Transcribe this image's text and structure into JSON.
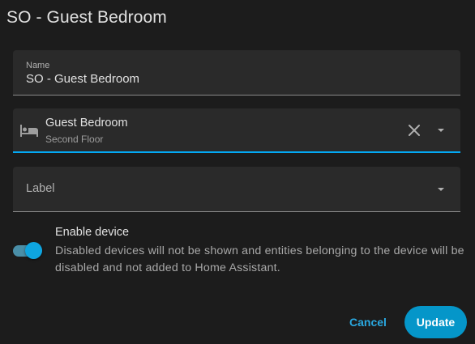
{
  "dialog": {
    "title": "SO - Guest Bedroom"
  },
  "name_field": {
    "label": "Name",
    "value": "SO - Guest Bedroom"
  },
  "area_field": {
    "icon": "bed-icon",
    "primary": "Guest Bedroom",
    "secondary": "Second Floor",
    "clear_icon": "close-icon",
    "dropdown_icon": "chevron-down-icon"
  },
  "label_field": {
    "placeholder": "Label",
    "dropdown_icon": "chevron-down-icon"
  },
  "enable_device": {
    "title": "Enable device",
    "description": "Disabled devices will not be shown and entities belonging to the device will be disabled and not added to Home Assistant.",
    "enabled": true
  },
  "actions": {
    "cancel_label": "Cancel",
    "update_label": "Update"
  },
  "colors": {
    "accent": "#03a9f4",
    "button": "#0596c9",
    "background": "#1c1c1c",
    "field_background": "#2a2a2a"
  }
}
